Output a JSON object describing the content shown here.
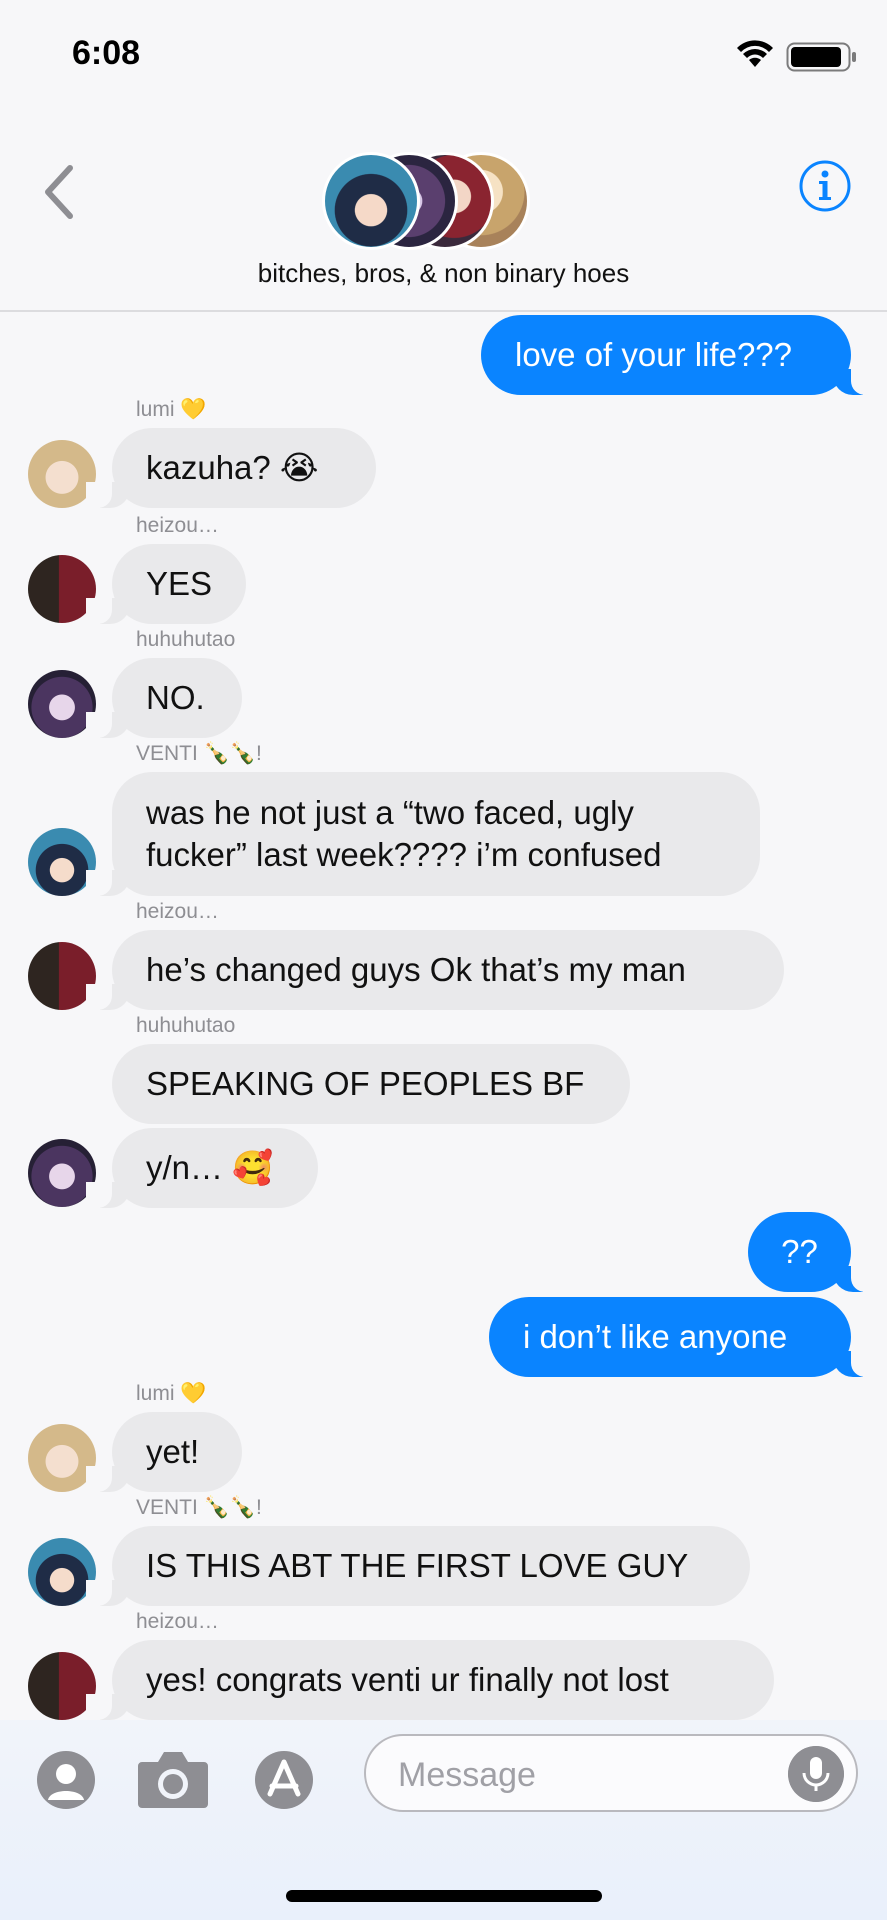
{
  "status": {
    "time": "6:08"
  },
  "header": {
    "group_name": "bitches, bros, & non binary hoes",
    "back_icon": "chevron-left-icon",
    "info_icon": "info-circle-icon"
  },
  "colors": {
    "accent": "#0a84ff",
    "incoming_bubble": "#e9e9eb",
    "background": "#f7f7f9"
  },
  "messages": [
    {
      "dir": "out",
      "text": "love of your life???"
    },
    {
      "dir": "in",
      "sender": "lumi 💛",
      "text": "kazuha? 😭"
    },
    {
      "dir": "in",
      "sender": "heizou…",
      "text": "YES"
    },
    {
      "dir": "in",
      "sender": "huhuhutao",
      "text": "NO."
    },
    {
      "dir": "in",
      "sender": "VENTI 🍾🍾!",
      "text": "was he not just a “two faced, ugly fucker” last week???? i’m confused"
    },
    {
      "dir": "in",
      "sender": "heizou…",
      "text": "he’s changed guys Ok that’s my man"
    },
    {
      "dir": "in",
      "sender": "huhuhutao",
      "text": "SPEAKING OF PEOPLES BF"
    },
    {
      "dir": "in",
      "text": "y/n… 🥰"
    },
    {
      "dir": "out",
      "text": "??"
    },
    {
      "dir": "out",
      "text": "i don’t like anyone"
    },
    {
      "dir": "in",
      "sender": "lumi 💛",
      "text": "yet!"
    },
    {
      "dir": "in",
      "sender": "VENTI 🍾🍾!",
      "text": "IS THIS ABT THE FIRST LOVE GUY"
    },
    {
      "dir": "in",
      "sender": "heizou…",
      "text": "yes! congrats venti ur finally not lost"
    }
  ],
  "composer": {
    "placeholder": "Message",
    "buttons": [
      "contact-icon",
      "camera-icon",
      "app-store-icon"
    ],
    "mic_icon": "microphone-icon"
  }
}
